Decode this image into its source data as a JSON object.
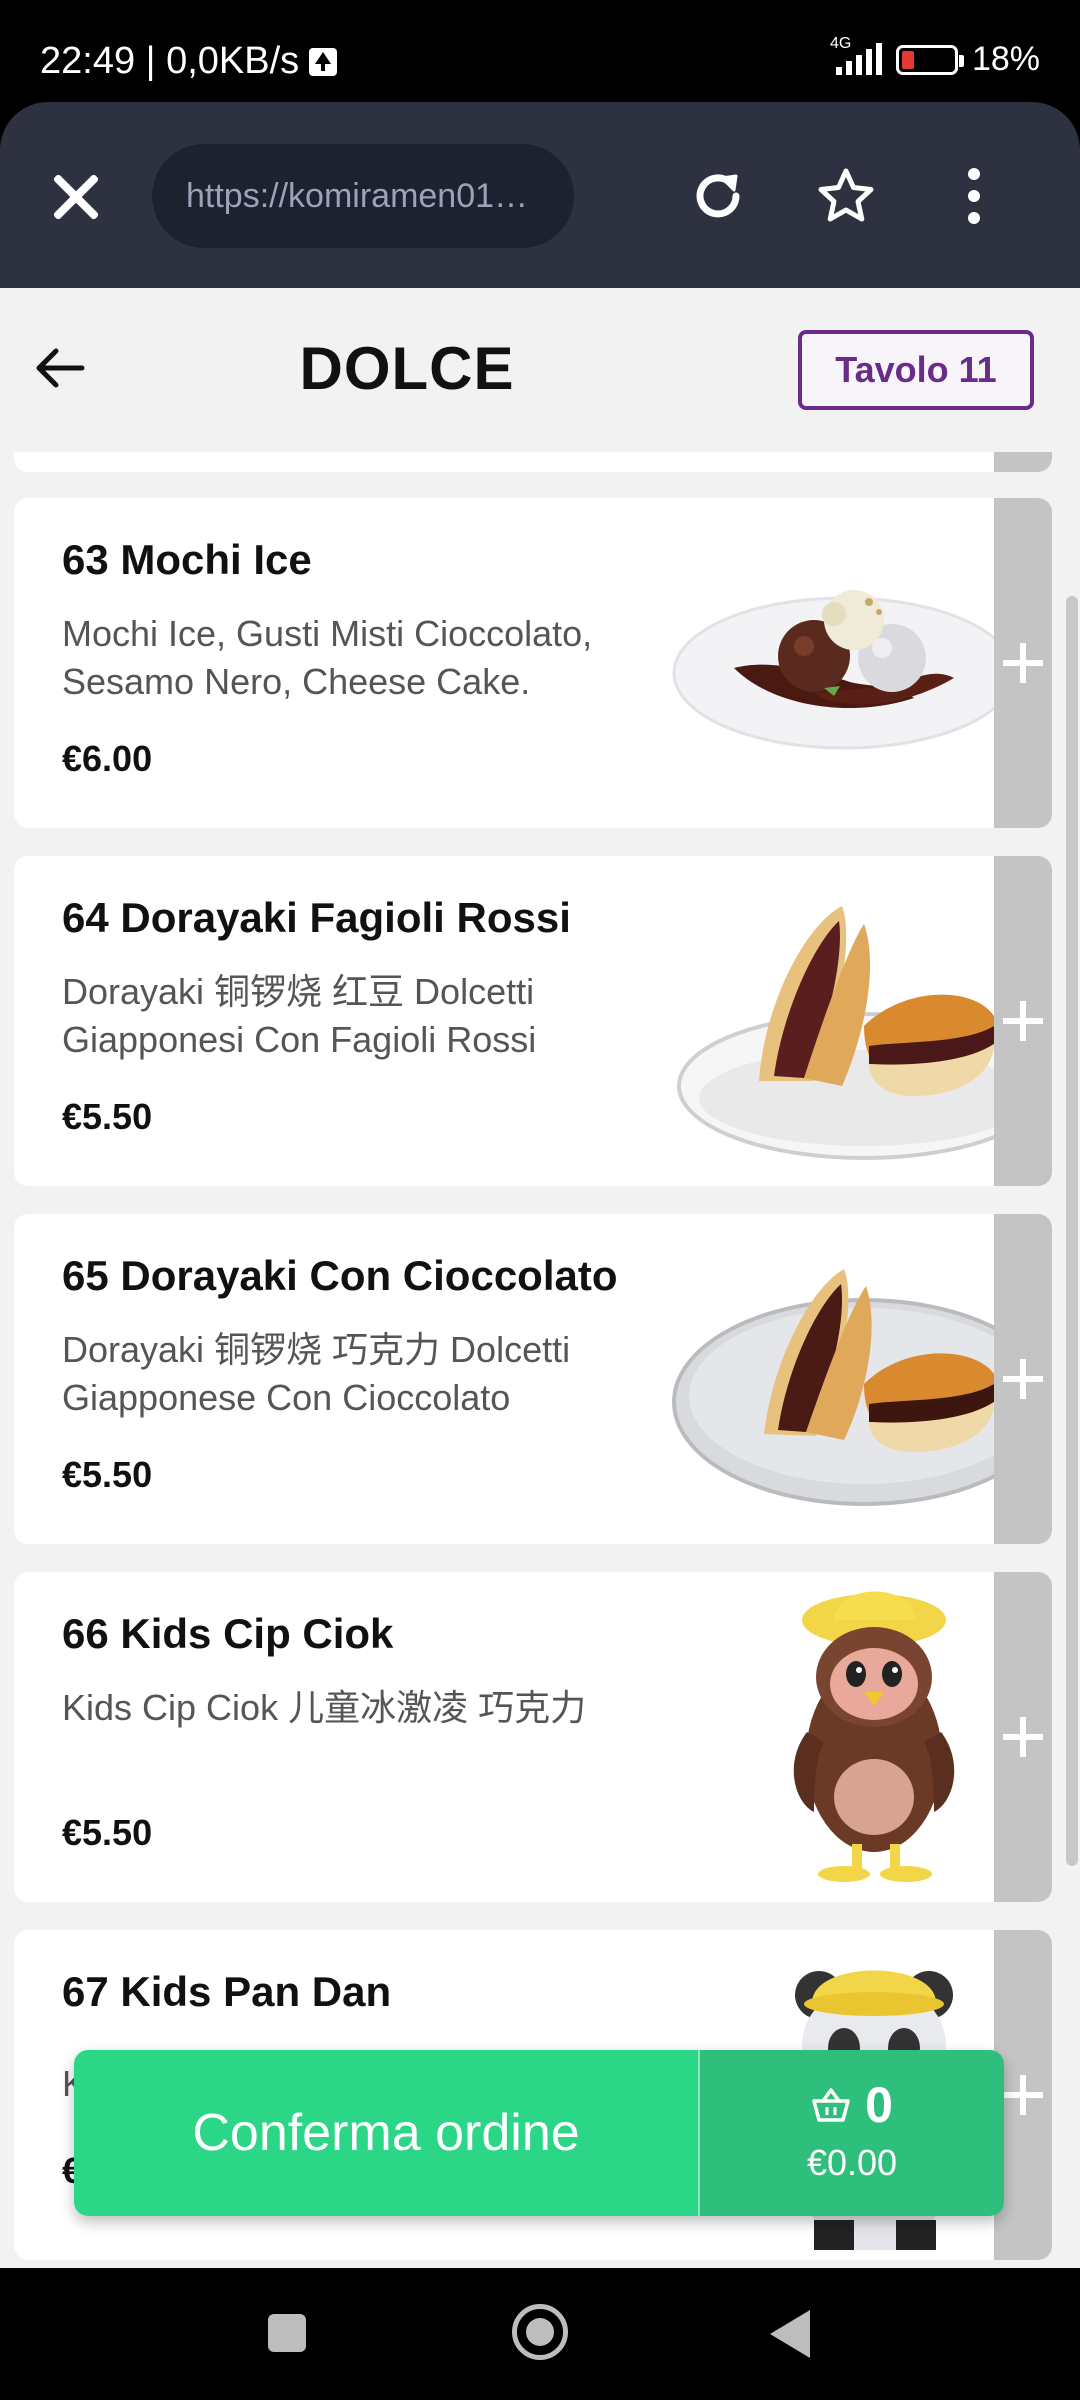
{
  "status_bar": {
    "time_speed": "22:49 | 0,0KB/s",
    "network": "4G",
    "battery": "18%"
  },
  "browser": {
    "url": "https://komiramen01…"
  },
  "header": {
    "title": "DOLCE",
    "table": "Tavolo 11"
  },
  "items": [
    {
      "name": "63 Mochi Ice",
      "desc": "Mochi Ice, Gusti Misti Cioccolato, Sesamo Nero, Cheese Cake.",
      "price": "€6.00"
    },
    {
      "name": "64 Dorayaki Fagioli Rossi",
      "desc": "Dorayaki 铜锣烧 红豆 Dolcetti Giapponesi Con Fagioli Rossi",
      "price": "€5.50"
    },
    {
      "name": "65 Dorayaki Con Cioccolato",
      "desc": "Dorayaki 铜锣烧 巧克力 Dolcetti Giapponese Con Cioccolato",
      "price": "€5.50"
    },
    {
      "name": "66 Kids Cip Ciok",
      "desc": "Kids Cip Ciok 儿童冰激凌 巧克力",
      "price": "€5.50"
    },
    {
      "name": "67 Kids Pan Dan",
      "desc": "K",
      "price": "€"
    }
  ],
  "order_bar": {
    "confirm_label": "Conferma ordine",
    "count": "0",
    "total": "€0.00"
  },
  "colors": {
    "accent_purple": "#6a2b8a",
    "confirm_green": "#2bd787",
    "cart_green": "#2fbf7c",
    "browser_bg": "#2d3140"
  }
}
